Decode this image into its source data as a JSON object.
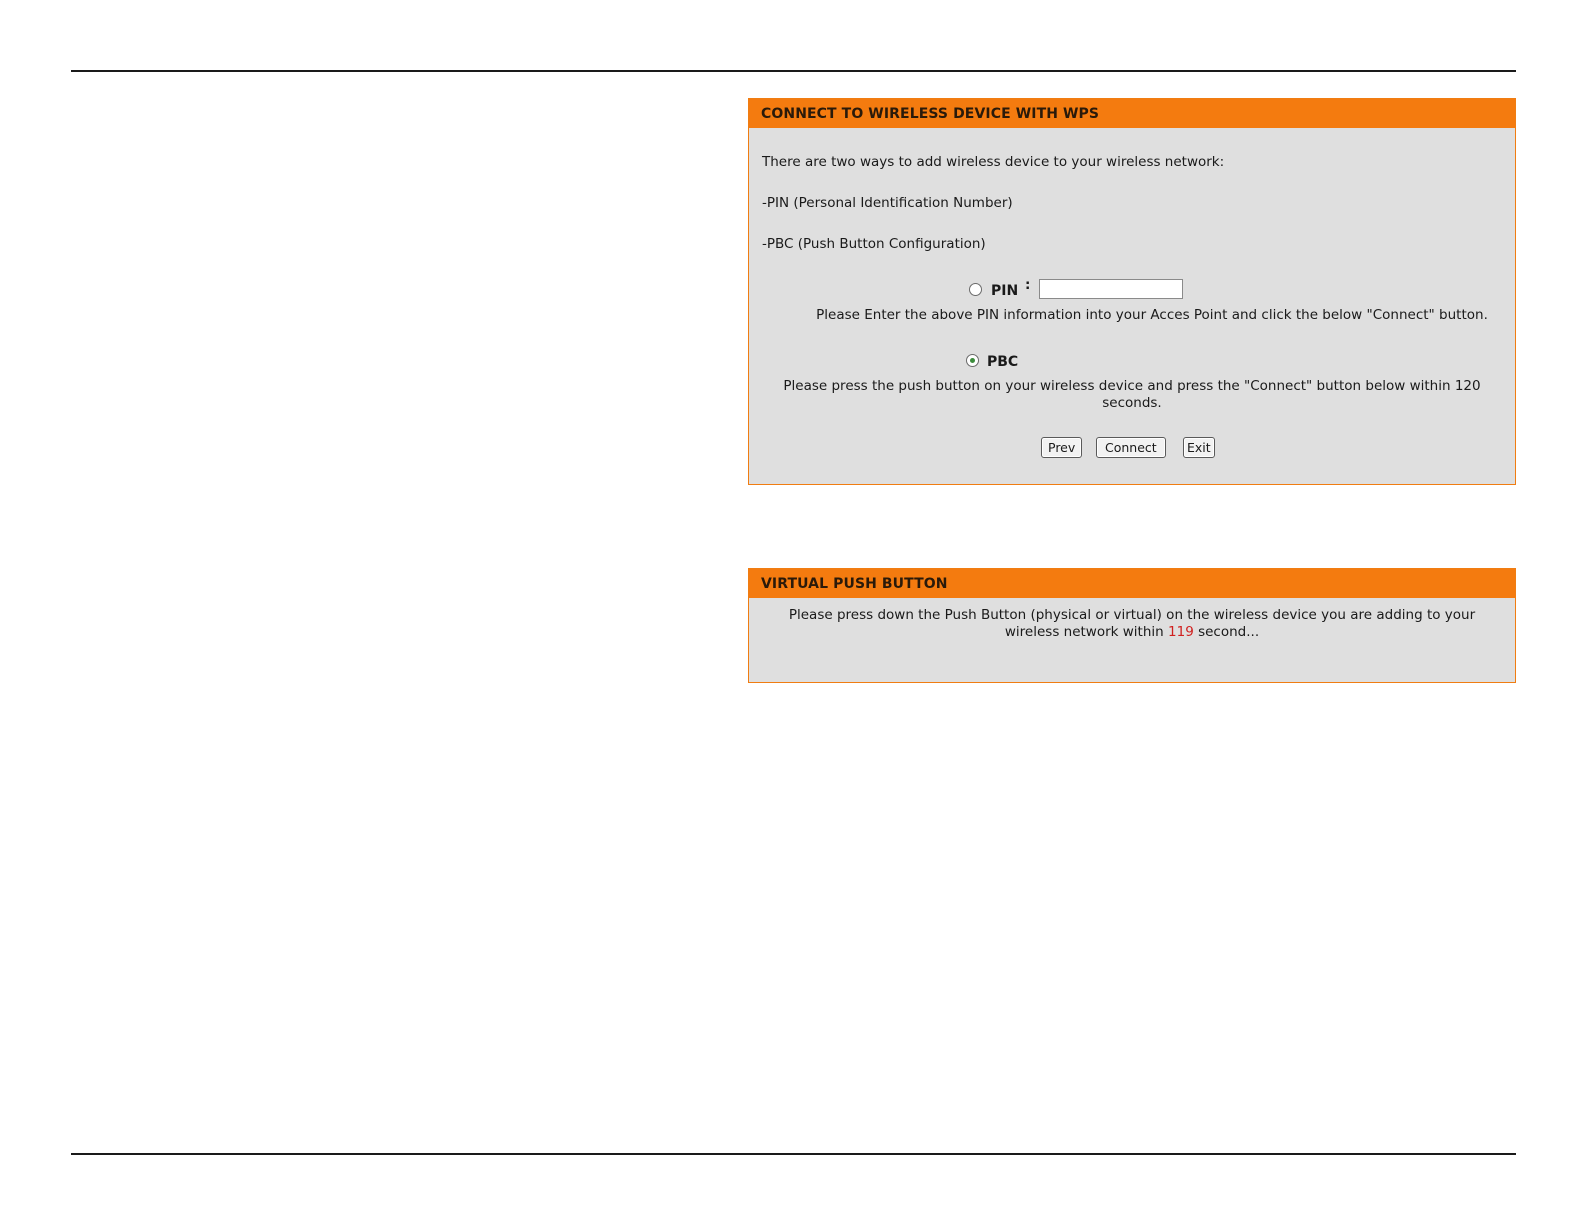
{
  "wps": {
    "title": "CONNECT TO WIRELESS DEVICE WITH WPS",
    "intro": "There are two ways to add wireless device to your wireless network:",
    "method_pin": "-PIN (Personal Identification Number)",
    "method_pbc": "-PBC (Push Button Configuration)",
    "pin_option": {
      "label": "PIN",
      "colon": ":",
      "value": "",
      "selected": false,
      "hint": "Please Enter the above PIN information into your Acces Point and click the below \"Connect\" button."
    },
    "pbc_option": {
      "label": "PBC",
      "selected": true,
      "hint": "Please press the push button on your wireless device and press the \"Connect\" button below within 120 seconds."
    },
    "buttons": {
      "prev": "Prev",
      "connect": "Connect",
      "exit": "Exit"
    }
  },
  "vpb": {
    "title": "VIRTUAL PUSH BUTTON",
    "message_before": "Please press down the Push Button (physical or virtual) on the wireless device you are adding to your wireless network within",
    "countdown": "119",
    "message_after": "second..."
  },
  "colors": {
    "header_orange": "#f47b0f",
    "panel_gray": "#dfdfdf",
    "countdown_red": "#d0201f"
  }
}
